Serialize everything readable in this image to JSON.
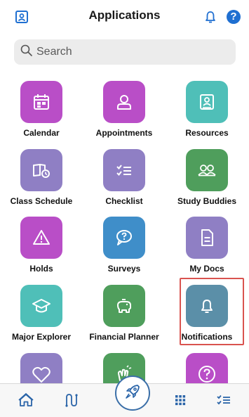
{
  "header": {
    "title": "Applications",
    "left_icon": "profile-card-icon",
    "bell_icon": "bell-icon",
    "help_icon": "help-icon",
    "help_glyph": "?"
  },
  "search": {
    "placeholder": "Search"
  },
  "apps": [
    {
      "label": "Calendar",
      "icon": "calendar-icon",
      "color": "#b94ec7"
    },
    {
      "label": "Appointments",
      "icon": "person-icon",
      "color": "#b94ec7"
    },
    {
      "label": "Resources",
      "icon": "id-card-icon",
      "color": "#4fbfb8"
    },
    {
      "label": "Class Schedule",
      "icon": "book-clock-icon",
      "color": "#8f7fc4"
    },
    {
      "label": "Checklist",
      "icon": "checklist-icon",
      "color": "#8f7fc4"
    },
    {
      "label": "Study Buddies",
      "icon": "people-icon",
      "color": "#4f9e5c"
    },
    {
      "label": "Holds",
      "icon": "warning-icon",
      "color": "#b94ec7"
    },
    {
      "label": "Surveys",
      "icon": "chat-question-icon",
      "color": "#3f8ec9"
    },
    {
      "label": "My Docs",
      "icon": "document-icon",
      "color": "#8f7fc4"
    },
    {
      "label": "Major Explorer",
      "icon": "graduation-cap-icon",
      "color": "#4fbfb8"
    },
    {
      "label": "Financial Planner",
      "icon": "piggy-bank-icon",
      "color": "#4f9e5c"
    },
    {
      "label": "Notifications",
      "icon": "bell-icon",
      "color": "#5b8fa8"
    },
    {
      "label": "",
      "icon": "heart-icon",
      "color": "#8f7fc4"
    },
    {
      "label": "",
      "icon": "clapping-hands-icon",
      "color": "#4f9e5c"
    },
    {
      "label": "",
      "icon": "question-circle-icon",
      "color": "#b94ec7"
    }
  ],
  "bottom_nav": {
    "items": [
      "home-icon",
      "route-icon",
      "rocket-icon",
      "grid-icon",
      "checklist-icon"
    ]
  },
  "accent_color": "#1f6fd1",
  "highlight_color": "#d9534f"
}
